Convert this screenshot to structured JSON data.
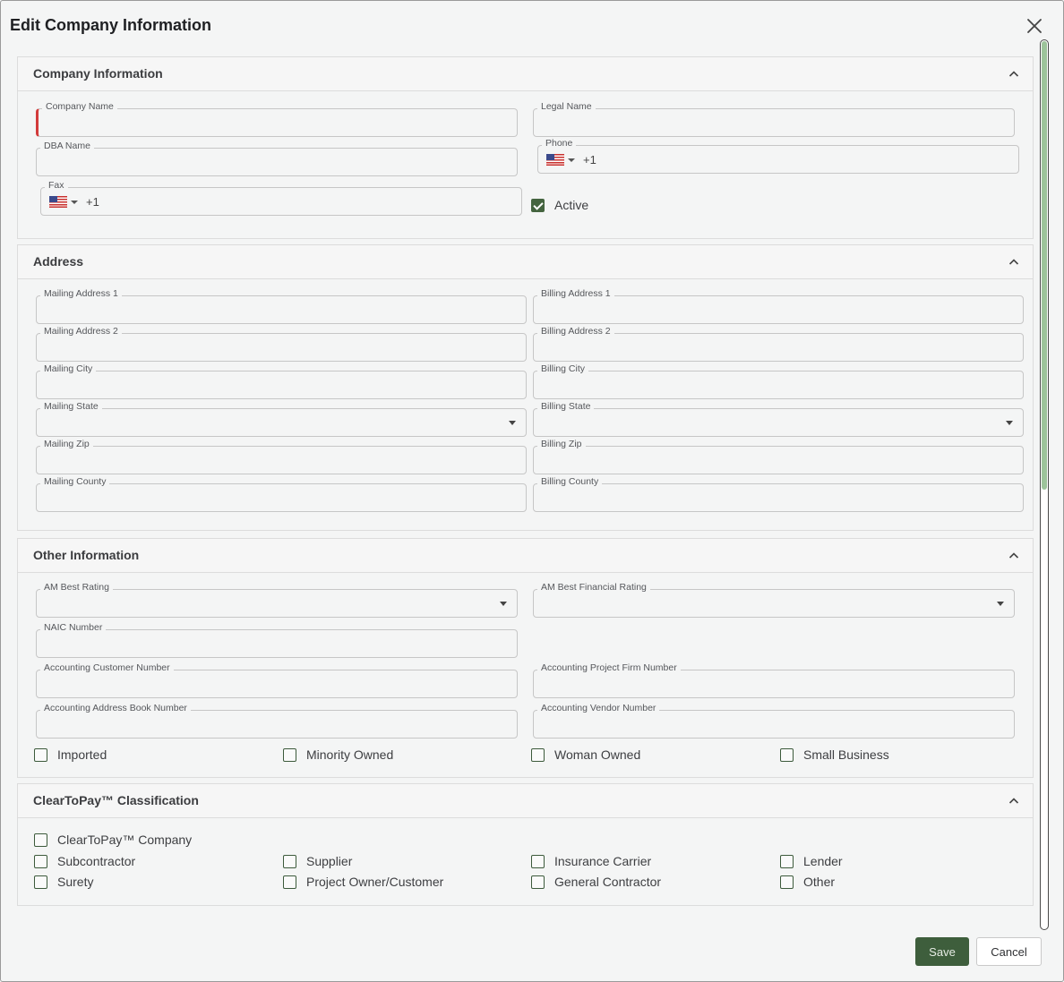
{
  "title": "Edit Company Information",
  "colors": {
    "accent": "#3e5e3c",
    "required": "#d23b3b",
    "scrollbar": "#9dc49b"
  },
  "company": {
    "title": "Company Information",
    "company_name": "Company Name",
    "legal_name": "Legal Name",
    "dba_name": "DBA Name",
    "phone": {
      "label": "Phone",
      "code": "+1"
    },
    "fax": {
      "label": "Fax",
      "code": "+1"
    },
    "active_label": "Active"
  },
  "address": {
    "title": "Address",
    "mailing_address1": "Mailing Address 1",
    "billing_address1": "Billing Address 1",
    "mailing_address2": "Mailing Address 2",
    "billing_address2": "Billing Address 2",
    "mailing_city": "Mailing City",
    "billing_city": "Billing City",
    "mailing_state": "Mailing State",
    "billing_state": "Billing State",
    "mailing_zip": "Mailing Zip",
    "billing_zip": "Billing Zip",
    "mailing_county": "Mailing County",
    "billing_county": "Billing County"
  },
  "other": {
    "title": "Other Information",
    "am_best_rating": "AM Best Rating",
    "am_best_financial": "AM Best Financial Rating",
    "naic": "NAIC Number",
    "acct_customer": "Accounting Customer Number",
    "acct_project_firm": "Accounting Project Firm Number",
    "acct_address_book": "Accounting Address Book Number",
    "acct_vendor": "Accounting Vendor Number",
    "imported": "Imported",
    "minority": "Minority Owned",
    "woman": "Woman Owned",
    "small_business": "Small Business"
  },
  "classification": {
    "title": "ClearToPay™ Classification",
    "ctp_company": "ClearToPay™ Company",
    "subcontractor": "Subcontractor",
    "supplier": "Supplier",
    "insurance_carrier": "Insurance Carrier",
    "lender": "Lender",
    "surety": "Surety",
    "project_owner": "Project Owner/Customer",
    "general_contractor": "General Contractor",
    "other": "Other"
  },
  "buttons": {
    "save": "Save",
    "cancel": "Cancel"
  }
}
